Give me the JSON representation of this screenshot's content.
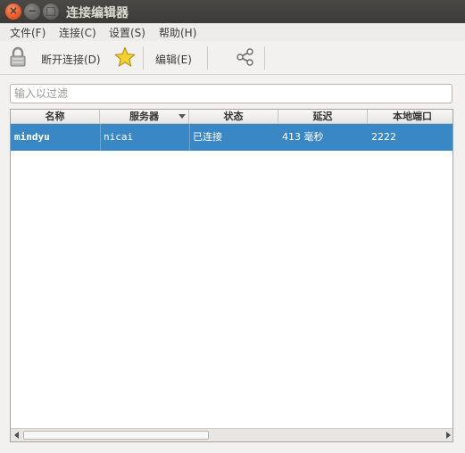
{
  "window": {
    "title": "连接编辑器",
    "close_glyph": "×",
    "min_glyph": "−",
    "max_glyph": "□"
  },
  "menu": [
    {
      "label": "文件(F)"
    },
    {
      "label": "连接(C)"
    },
    {
      "label": "设置(S)"
    },
    {
      "label": "帮助(H)"
    }
  ],
  "toolbar": {
    "disconnect_label": "断开连接(D)",
    "edit_label": "编辑(E)",
    "icons": [
      "lock-icon",
      "star-icon",
      "share-icon"
    ]
  },
  "filter": {
    "placeholder": "输入以过滤",
    "value": ""
  },
  "table": {
    "columns": [
      "名称",
      "服务器",
      "状态",
      "延迟",
      "本地端口"
    ],
    "sorted_column": "服务器",
    "rows": [
      {
        "name": "mindyu",
        "server": "nicai",
        "status": "已连接",
        "latency": "413 毫秒",
        "local_port": "2222"
      }
    ]
  },
  "colors": {
    "titlebar": "#3c3b37",
    "selection": "#3a87c6",
    "close_button": "#e95420"
  }
}
